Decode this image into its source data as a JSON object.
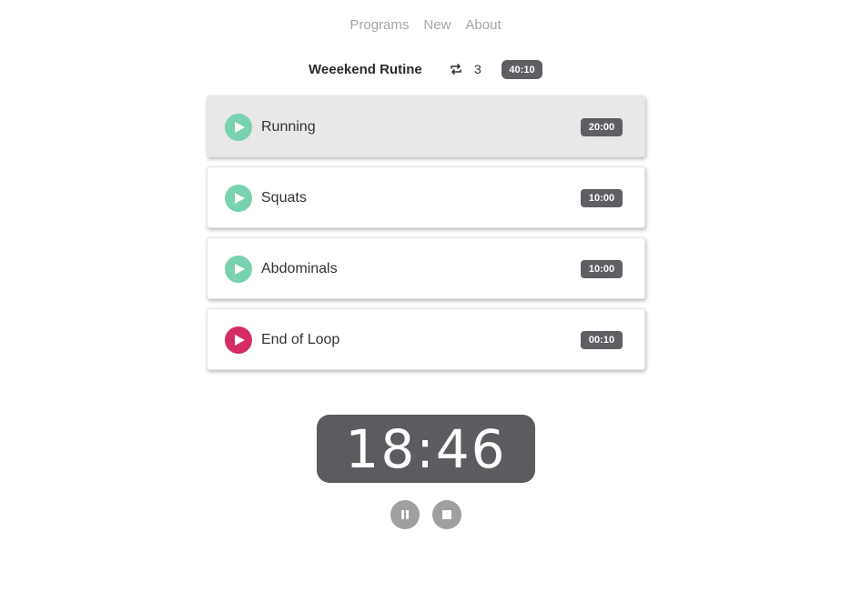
{
  "nav": {
    "programs": "Programs",
    "new": "New",
    "about": "About"
  },
  "program": {
    "title": "Weeekend Rutine",
    "repeat_count": "3",
    "total_time": "40:10"
  },
  "exercises": [
    {
      "name": "Running",
      "time": "20:00",
      "color": "#78d2b0",
      "active": true
    },
    {
      "name": "Squats",
      "time": "10:00",
      "color": "#78d2b0",
      "active": false
    },
    {
      "name": "Abdominals",
      "time": "10:00",
      "color": "#78d2b0",
      "active": false
    },
    {
      "name": "End of Loop",
      "time": "00:10",
      "color": "#d52c64",
      "active": false
    }
  ],
  "timer": {
    "display": "18:46"
  },
  "icons": {
    "repeat": "repeat-icon",
    "play": "play-icon",
    "pause": "pause-icon",
    "stop": "stop-icon"
  }
}
